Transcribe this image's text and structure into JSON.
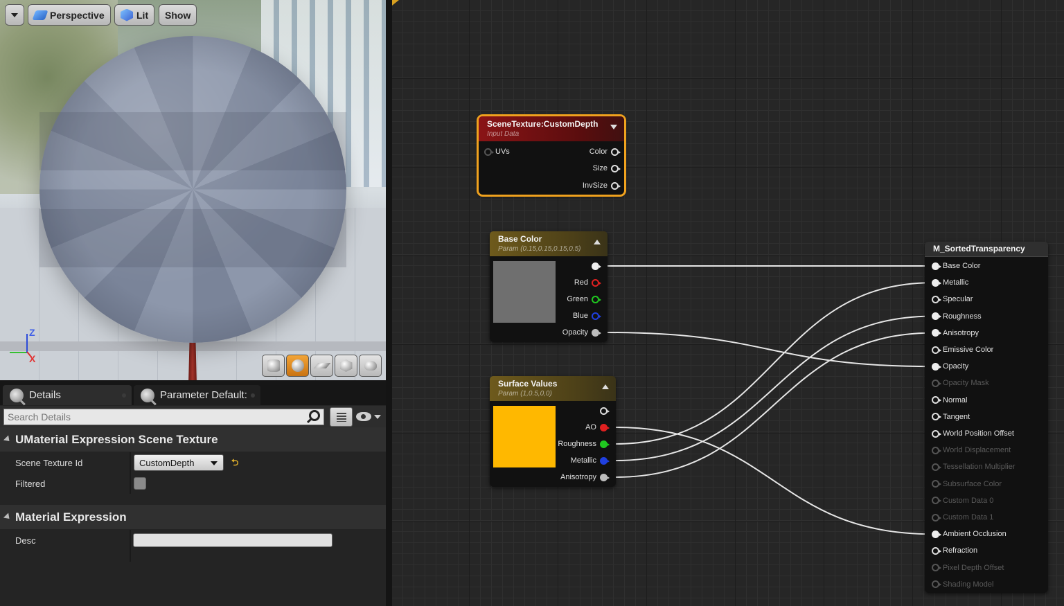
{
  "viewport": {
    "menu_button": "",
    "perspective_label": "Perspective",
    "lit_label": "Lit",
    "show_label": "Show",
    "axis_z": "Z",
    "axis_x": "X"
  },
  "details": {
    "tabs": [
      {
        "label": "Details"
      },
      {
        "label": "Parameter Default:"
      }
    ],
    "search_placeholder": "Search Details",
    "categories": [
      {
        "title": "UMaterial Expression Scene Texture"
      },
      {
        "title": "Material Expression"
      }
    ],
    "props": {
      "scene_texture_id": {
        "name": "Scene Texture Id",
        "value": "CustomDepth"
      },
      "filtered": {
        "name": "Filtered",
        "checked": false
      },
      "desc": {
        "name": "Desc",
        "value": ""
      }
    },
    "reset_glyph": "⮌"
  },
  "nodes": {
    "scene_texture": {
      "title": "SceneTexture:CustomDepth",
      "subtitle": "Input Data",
      "inputs": [
        "UVs"
      ],
      "outputs": [
        "Color",
        "Size",
        "InvSize"
      ]
    },
    "base_color": {
      "title": "Base Color",
      "subtitle": "Param (0.15,0.15,0.15,0.5)",
      "swatch_color": "#6f6f6f",
      "outputs": [
        "",
        "Red",
        "Green",
        "Blue",
        "Opacity"
      ]
    },
    "surface_values": {
      "title": "Surface Values",
      "subtitle": "Param (1,0.5,0,0)",
      "swatch_color": "#ffb800",
      "outputs": [
        "",
        "AO",
        "Roughness",
        "Metallic",
        "Anisotropy"
      ]
    },
    "material": {
      "title": "M_SortedTransparency",
      "inputs": [
        {
          "label": "Base Color",
          "enabled": true,
          "connected": true
        },
        {
          "label": "Metallic",
          "enabled": true,
          "connected": true
        },
        {
          "label": "Specular",
          "enabled": true,
          "connected": false
        },
        {
          "label": "Roughness",
          "enabled": true,
          "connected": true
        },
        {
          "label": "Anisotropy",
          "enabled": true,
          "connected": true
        },
        {
          "label": "Emissive Color",
          "enabled": true,
          "connected": false
        },
        {
          "label": "Opacity",
          "enabled": true,
          "connected": true
        },
        {
          "label": "Opacity Mask",
          "enabled": false,
          "connected": false
        },
        {
          "label": "Normal",
          "enabled": true,
          "connected": false
        },
        {
          "label": "Tangent",
          "enabled": true,
          "connected": false
        },
        {
          "label": "World Position Offset",
          "enabled": true,
          "connected": false
        },
        {
          "label": "World Displacement",
          "enabled": false,
          "connected": false
        },
        {
          "label": "Tessellation Multiplier",
          "enabled": false,
          "connected": false
        },
        {
          "label": "Subsurface Color",
          "enabled": false,
          "connected": false
        },
        {
          "label": "Custom Data 0",
          "enabled": false,
          "connected": false
        },
        {
          "label": "Custom Data 1",
          "enabled": false,
          "connected": false
        },
        {
          "label": "Ambient Occlusion",
          "enabled": true,
          "connected": true
        },
        {
          "label": "Refraction",
          "enabled": true,
          "connected": false
        },
        {
          "label": "Pixel Depth Offset",
          "enabled": false,
          "connected": false
        },
        {
          "label": "Shading Model",
          "enabled": false,
          "connected": false
        }
      ]
    }
  },
  "pin_colors": {
    "default": "#e8e8e8",
    "red": "#e02020",
    "green": "#20c820",
    "blue": "#2040e0",
    "grey": "#bdbdbd",
    "selection": "#f0a21e"
  }
}
